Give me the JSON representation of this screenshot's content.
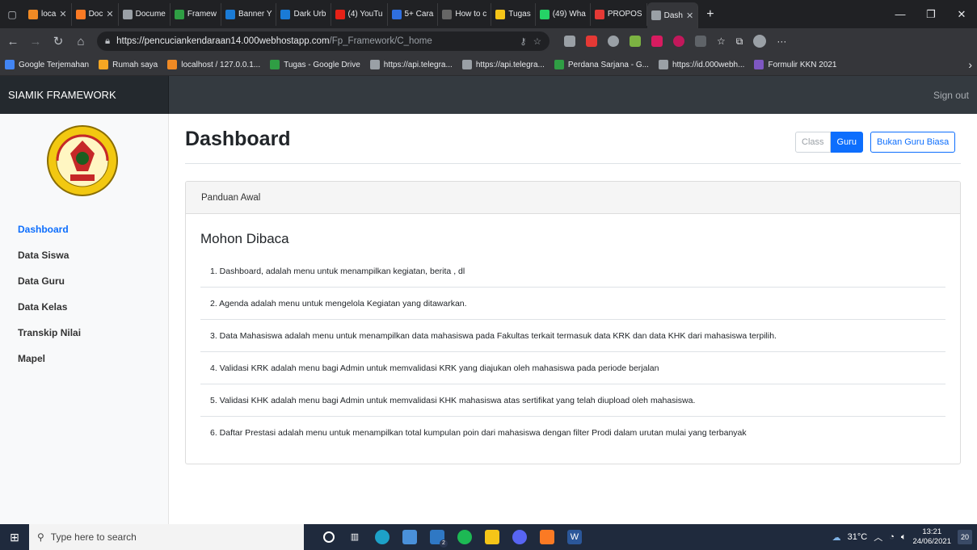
{
  "browser": {
    "tabs": [
      {
        "label": "loca",
        "icon": "xampp-icon",
        "color": "#f08a24",
        "closable": true
      },
      {
        "label": "Doc",
        "icon": "xampp-icon",
        "color": "#fb7a24",
        "closable": true
      },
      {
        "label": "Docume",
        "icon": "document-icon",
        "color": "#9aa0a6",
        "closable": false
      },
      {
        "label": "Framew",
        "icon": "google-drive-icon",
        "color": "#2f9e44",
        "closable": false
      },
      {
        "label": "Banner Y",
        "icon": "canva-icon",
        "color": "#1a7bd6",
        "closable": false
      },
      {
        "label": "Dark Urb",
        "icon": "canva-icon",
        "color": "#1a7bd6",
        "closable": false
      },
      {
        "label": "(4) YouTu",
        "icon": "youtube-icon",
        "color": "#e62117",
        "closable": false
      },
      {
        "label": "5+ Cara",
        "icon": "d-icon",
        "color": "#2f6fe0",
        "closable": false
      },
      {
        "label": "How to c",
        "icon": "wikihow-icon",
        "color": "#666666",
        "closable": false
      },
      {
        "label": "Tugas",
        "icon": "tugas-icon",
        "color": "#f5c518",
        "closable": false
      },
      {
        "label": "(49) Wha",
        "icon": "whatsapp-icon",
        "color": "#25d366",
        "closable": false
      },
      {
        "label": "PROPOS",
        "icon": "pdf-icon",
        "color": "#e53935",
        "closable": false
      },
      {
        "label": "Dash",
        "icon": "document-icon",
        "color": "#9aa0a6",
        "closable": true,
        "active": true
      }
    ],
    "new_tab": "+",
    "window_controls": {
      "minimize": "—",
      "restore": "❐",
      "close": "✕"
    },
    "url": {
      "host": "https://pencuciankendaraan14.000webhostapp.com",
      "path": "/Fp_Framework/C_home"
    },
    "bookmarks": [
      {
        "label": "Google Terjemahan",
        "color": "#4285f4"
      },
      {
        "label": "Rumah saya",
        "color": "#f5a623"
      },
      {
        "label": "localhost / 127.0.0.1...",
        "color": "#f08a24"
      },
      {
        "label": "Tugas - Google Drive",
        "color": "#2f9e44"
      },
      {
        "label": "https://api.telegra...",
        "color": "#9aa0a6"
      },
      {
        "label": "https://api.telegra...",
        "color": "#9aa0a6"
      },
      {
        "label": "Perdana Sarjana - G...",
        "color": "#2f9e44"
      },
      {
        "label": "https://id.000webh...",
        "color": "#9aa0a6"
      },
      {
        "label": "Formulir KKN 2021",
        "color": "#7e57c2"
      }
    ],
    "bookmarks_more": "›"
  },
  "app": {
    "brand": "SIAMIK FRAMEWORK",
    "sign_out": "Sign out",
    "sidebar": {
      "logo_icon": "university-logo-icon",
      "items": [
        {
          "label": "Dashboard",
          "active": true
        },
        {
          "label": "Data Siswa"
        },
        {
          "label": "Data Guru"
        },
        {
          "label": "Data Kelas"
        },
        {
          "label": "Transkip Nilai"
        },
        {
          "label": "Mapel"
        }
      ]
    },
    "page_title": "Dashboard",
    "toggle": {
      "class_label": "Class",
      "guru_label": "Guru",
      "selected": "Guru"
    },
    "bukan_guru_button": "Bukan Guru Biasa",
    "card": {
      "header": "Panduan Awal",
      "title": "Mohon Dibaca",
      "items": [
        "1. Dashboard, adalah menu untuk menampilkan kegiatan, berita , dl",
        "2. Agenda adalah menu untuk mengelola Kegiatan yang ditawarkan.",
        "3. Data Mahasiswa adalah menu untuk menampilkan data mahasiswa pada Fakultas terkait termasuk data KRK dan data KHK dari mahasiswa terpilih.",
        "4. Validasi KRK adalah menu bagi Admin untuk memvalidasi KRK yang diajukan oleh mahasiswa pada periode berjalan",
        "5. Validasi KHK adalah menu bagi Admin untuk memvalidasi KHK mahasiswa atas sertifikat yang telah diupload oleh mahasiswa.",
        "6. Daftar Prestasi adalah menu untuk menampilkan total kumpulan poin dari mahasiswa dengan filter Prodi dalam urutan mulai yang terbanyak"
      ]
    }
  },
  "taskbar": {
    "search_placeholder": "Type here to search",
    "weather": "31°C",
    "time": "13:21",
    "date": "24/06/2021",
    "notifications": "20",
    "mail_badge": "2"
  },
  "colors": {
    "primary": "#0d6efd",
    "navbar": "#343a40",
    "brand_bg": "#24292e",
    "taskbar": "#1f2a3d"
  }
}
